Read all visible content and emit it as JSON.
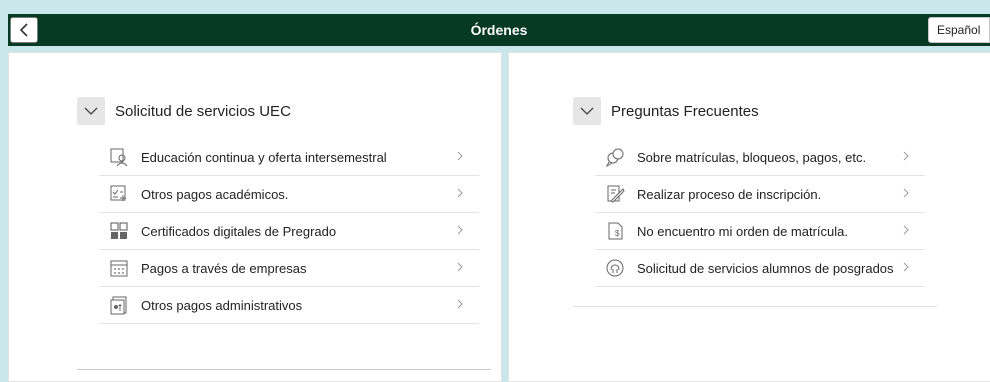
{
  "header": {
    "title": "Órdenes",
    "language": "Español"
  },
  "left": {
    "title": "Solicitud de servicios UEC",
    "items": [
      {
        "label": "Educación continua y oferta intersemestral",
        "icon": "person-board-icon"
      },
      {
        "label": "Otros pagos académicos.",
        "icon": "checklist-add-icon"
      },
      {
        "label": "Certificados digitales de Pregrado",
        "icon": "grid-apps-icon"
      },
      {
        "label": "Pagos a través de empresas",
        "icon": "calendar-grid-icon"
      },
      {
        "label": "Otros pagos administrativos",
        "icon": "document-payment-icon"
      }
    ]
  },
  "right": {
    "title": "Preguntas Frecuentes",
    "items": [
      {
        "label": "Sobre matrículas, bloqueos, pagos, etc.",
        "icon": "discussion-icon"
      },
      {
        "label": "Realizar proceso de inscripción.",
        "icon": "edit-document-icon"
      },
      {
        "label": "No encuentro mi orden de matrícula.",
        "icon": "document-dollar-icon"
      },
      {
        "label": "Solicitud de servicios alumnos de posgrados",
        "icon": "support-globe-icon"
      }
    ]
  }
}
